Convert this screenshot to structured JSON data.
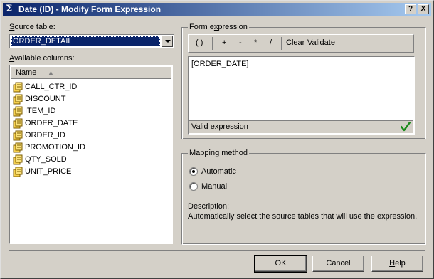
{
  "window": {
    "title": "Date (ID) - Modify Form Expression",
    "help_btn": "?",
    "close_btn": "X"
  },
  "source_table": {
    "label_prefix": "S",
    "label_rest": "ource table:",
    "value": "ORDER_DETAIL"
  },
  "available_columns": {
    "label_prefix": "A",
    "label_rest": "vailable columns:",
    "header": "Name",
    "sort_glyph": "▲",
    "items": [
      "CALL_CTR_ID",
      "DISCOUNT",
      "ITEM_ID",
      "ORDER_DATE",
      "ORDER_ID",
      "PROMOTION_ID",
      "QTY_SOLD",
      "UNIT_PRICE"
    ]
  },
  "form_expression": {
    "title_pre": "Form e",
    "title_u": "x",
    "title_post": "pression",
    "toolbar": {
      "parens": "( )",
      "plus": "+",
      "minus": "-",
      "multiply": "*",
      "divide": "/",
      "clear": "Clear",
      "validate_pre": "Va",
      "validate_u": "l",
      "validate_post": "idate"
    },
    "expression": "[ORDER_DATE]",
    "status": "Valid expression"
  },
  "mapping_method": {
    "title": "Mapping method",
    "automatic": "Automatic",
    "manual": "Manual",
    "description_label": "Description:",
    "description": "Automatically select the source tables that will use the expression."
  },
  "buttons": {
    "ok": "OK",
    "cancel": "Cancel",
    "help_u": "H",
    "help_rest": "elp"
  }
}
